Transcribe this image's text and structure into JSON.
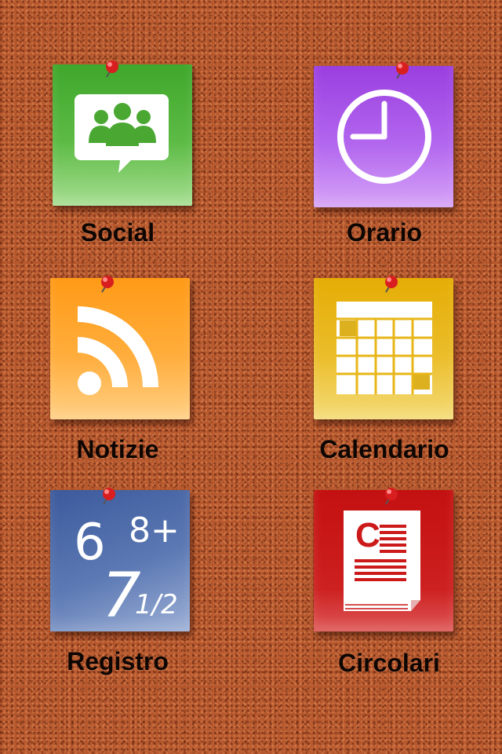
{
  "tiles": {
    "social": {
      "label": "Social",
      "icon": "chat-group-icon",
      "color": "#4cb035"
    },
    "orario": {
      "label": "Orario",
      "icon": "clock-icon",
      "color": "#a650e8"
    },
    "notizie": {
      "label": "Notizie",
      "icon": "rss-icon",
      "color": "#ffa12a"
    },
    "calendario": {
      "label": "Calendario",
      "icon": "calendar-icon",
      "color": "#e8b415"
    },
    "registro": {
      "label": "Registro",
      "icon": "grades-icon",
      "color": "#4a68aa",
      "grades": [
        "6",
        "8+",
        "7",
        "1/2"
      ]
    },
    "circolari": {
      "label": "Circolari",
      "icon": "circular-document-icon",
      "color": "#c81414",
      "doc_letter": "C"
    }
  },
  "pin_color": "#d81e1e"
}
